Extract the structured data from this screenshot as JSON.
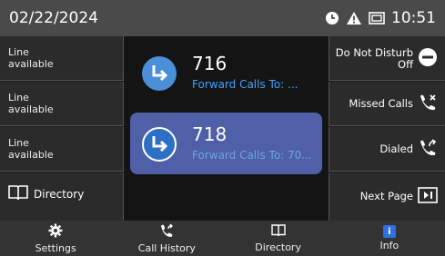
{
  "status": {
    "date": "02/22/2024",
    "time": "10:51"
  },
  "left_keys": [
    {
      "label": "Line\navailable"
    },
    {
      "label": "Line\navailable"
    },
    {
      "label": "Line\navailable"
    },
    {
      "label": "Directory"
    }
  ],
  "calls": [
    {
      "number": "716",
      "forward": "Forward Calls To: ..."
    },
    {
      "number": "718",
      "forward": "Forward Calls To: 70..."
    }
  ],
  "right_keys": [
    {
      "label_line1": "Do Not Disturb",
      "label_line2": "Off"
    },
    {
      "label_line1": "Missed Calls"
    },
    {
      "label_line1": "Dialed"
    },
    {
      "label_line1": "Next Page"
    }
  ],
  "nav": [
    {
      "label": "Settings"
    },
    {
      "label": "Call History"
    },
    {
      "label": "Directory"
    },
    {
      "label": "Info"
    }
  ],
  "colors": {
    "accent": "#2f6fe0",
    "forward_text": "#3fa3ff",
    "selected_bg": "#4f5fa8"
  }
}
